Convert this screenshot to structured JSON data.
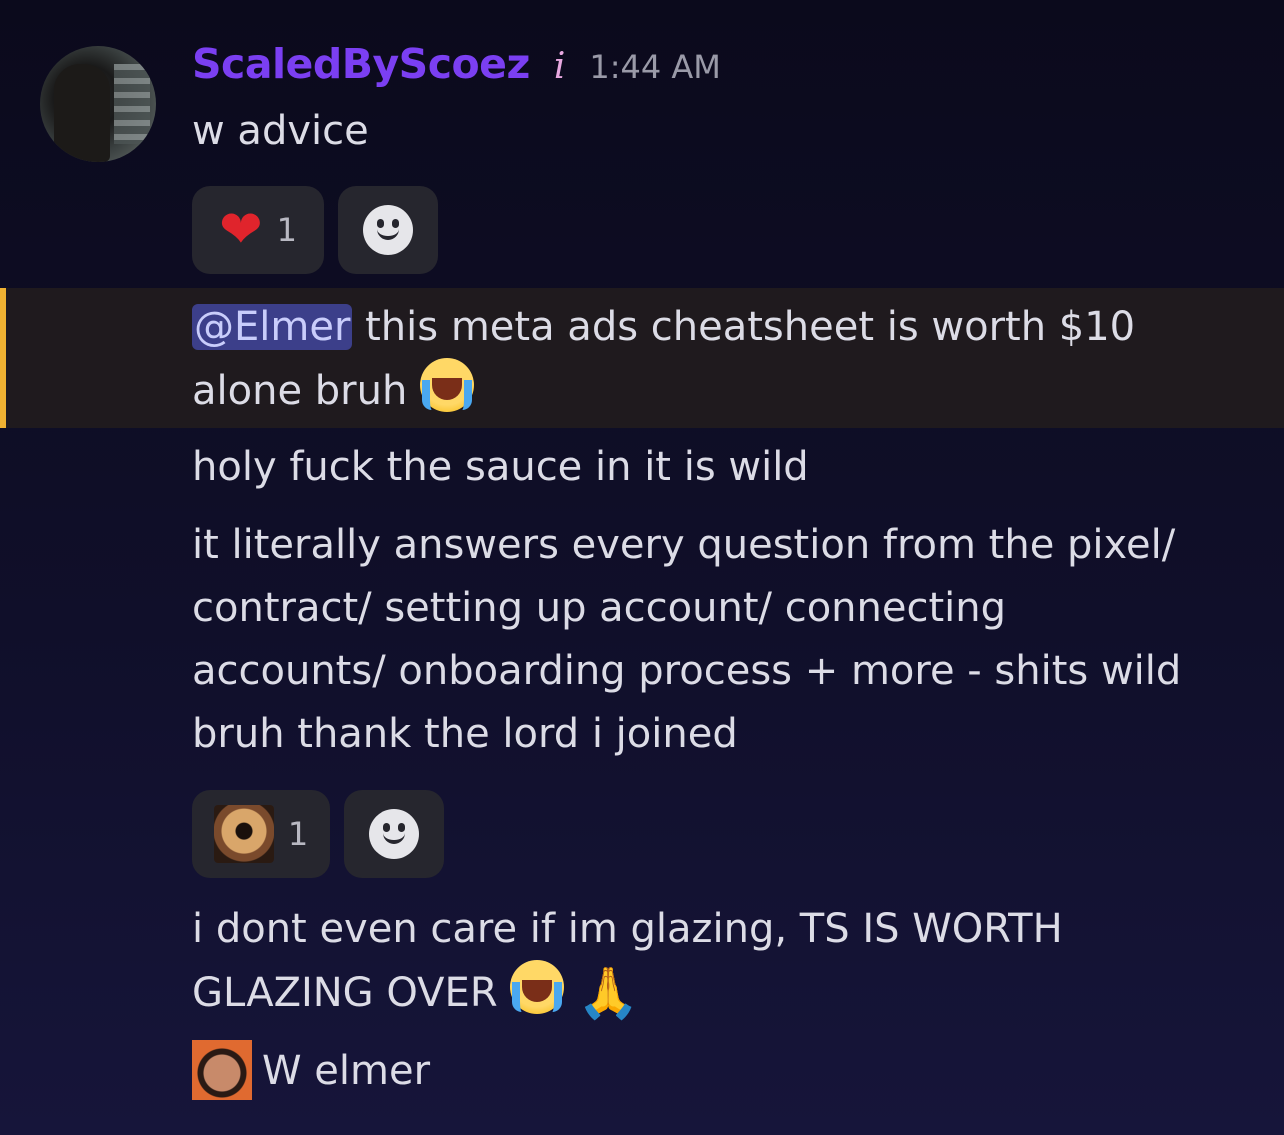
{
  "message": {
    "username": "ScaledByScoez",
    "role_icon": "i",
    "timestamp": "1:44 AM",
    "lines": {
      "first": "w advice",
      "mention": "@Elmer",
      "second_a": " this meta ads cheatsheet is worth $10",
      "second_b": "alone bruh ",
      "third": "holy fuck the sauce in it is wild",
      "fourth_1": "it literally answers every question from the pixel/",
      "fourth_2": "contract/ setting up account/ connecting",
      "fourth_3": "accounts/ onboarding process + more - shits wild",
      "fourth_4": "bruh thank the lord i joined",
      "fifth_1": "i dont even care if im glazing, TS IS WORTH",
      "fifth_2": "GLAZING OVER ",
      "sixth": "W elmer"
    }
  },
  "reactions": {
    "first": {
      "emoji": "heart-emoji",
      "count": "1"
    },
    "second": {
      "emoji": "donut-emoji",
      "count": "1"
    }
  },
  "colors": {
    "username": "#7b3ff2",
    "mention_bg": "#3c3f8a",
    "highlight_bar": "#f0b232"
  }
}
